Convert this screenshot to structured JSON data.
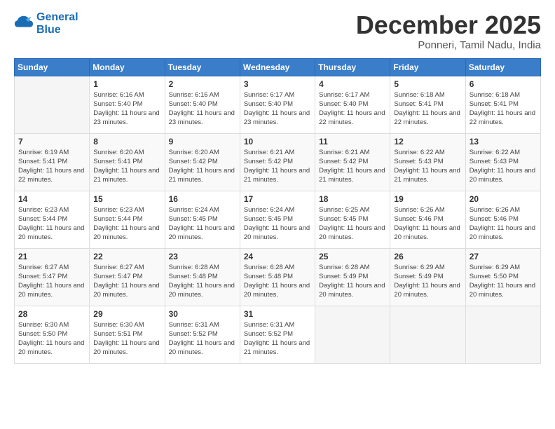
{
  "logo": {
    "line1": "General",
    "line2": "Blue"
  },
  "header": {
    "month": "December 2025",
    "location": "Ponneri, Tamil Nadu, India"
  },
  "weekdays": [
    "Sunday",
    "Monday",
    "Tuesday",
    "Wednesday",
    "Thursday",
    "Friday",
    "Saturday"
  ],
  "weeks": [
    [
      {
        "day": "",
        "info": ""
      },
      {
        "day": "1",
        "info": "Sunrise: 6:16 AM\nSunset: 5:40 PM\nDaylight: 11 hours\nand 23 minutes."
      },
      {
        "day": "2",
        "info": "Sunrise: 6:16 AM\nSunset: 5:40 PM\nDaylight: 11 hours\nand 23 minutes."
      },
      {
        "day": "3",
        "info": "Sunrise: 6:17 AM\nSunset: 5:40 PM\nDaylight: 11 hours\nand 23 minutes."
      },
      {
        "day": "4",
        "info": "Sunrise: 6:17 AM\nSunset: 5:40 PM\nDaylight: 11 hours\nand 22 minutes."
      },
      {
        "day": "5",
        "info": "Sunrise: 6:18 AM\nSunset: 5:41 PM\nDaylight: 11 hours\nand 22 minutes."
      },
      {
        "day": "6",
        "info": "Sunrise: 6:18 AM\nSunset: 5:41 PM\nDaylight: 11 hours\nand 22 minutes."
      }
    ],
    [
      {
        "day": "7",
        "info": ""
      },
      {
        "day": "8",
        "info": "Sunrise: 6:20 AM\nSunset: 5:41 PM\nDaylight: 11 hours\nand 21 minutes."
      },
      {
        "day": "9",
        "info": "Sunrise: 6:20 AM\nSunset: 5:42 PM\nDaylight: 11 hours\nand 21 minutes."
      },
      {
        "day": "10",
        "info": "Sunrise: 6:21 AM\nSunset: 5:42 PM\nDaylight: 11 hours\nand 21 minutes."
      },
      {
        "day": "11",
        "info": "Sunrise: 6:21 AM\nSunset: 5:42 PM\nDaylight: 11 hours\nand 21 minutes."
      },
      {
        "day": "12",
        "info": "Sunrise: 6:22 AM\nSunset: 5:43 PM\nDaylight: 11 hours\nand 21 minutes."
      },
      {
        "day": "13",
        "info": "Sunrise: 6:22 AM\nSunset: 5:43 PM\nDaylight: 11 hours\nand 20 minutes."
      }
    ],
    [
      {
        "day": "14",
        "info": ""
      },
      {
        "day": "15",
        "info": "Sunrise: 6:23 AM\nSunset: 5:44 PM\nDaylight: 11 hours\nand 20 minutes."
      },
      {
        "day": "16",
        "info": "Sunrise: 6:24 AM\nSunset: 5:45 PM\nDaylight: 11 hours\nand 20 minutes."
      },
      {
        "day": "17",
        "info": "Sunrise: 6:24 AM\nSunset: 5:45 PM\nDaylight: 11 hours\nand 20 minutes."
      },
      {
        "day": "18",
        "info": "Sunrise: 6:25 AM\nSunset: 5:45 PM\nDaylight: 11 hours\nand 20 minutes."
      },
      {
        "day": "19",
        "info": "Sunrise: 6:26 AM\nSunset: 5:46 PM\nDaylight: 11 hours\nand 20 minutes."
      },
      {
        "day": "20",
        "info": "Sunrise: 6:26 AM\nSunset: 5:46 PM\nDaylight: 11 hours\nand 20 minutes."
      }
    ],
    [
      {
        "day": "21",
        "info": ""
      },
      {
        "day": "22",
        "info": "Sunrise: 6:27 AM\nSunset: 5:47 PM\nDaylight: 11 hours\nand 20 minutes."
      },
      {
        "day": "23",
        "info": "Sunrise: 6:28 AM\nSunset: 5:48 PM\nDaylight: 11 hours\nand 20 minutes."
      },
      {
        "day": "24",
        "info": "Sunrise: 6:28 AM\nSunset: 5:48 PM\nDaylight: 11 hours\nand 20 minutes."
      },
      {
        "day": "25",
        "info": "Sunrise: 6:28 AM\nSunset: 5:49 PM\nDaylight: 11 hours\nand 20 minutes."
      },
      {
        "day": "26",
        "info": "Sunrise: 6:29 AM\nSunset: 5:49 PM\nDaylight: 11 hours\nand 20 minutes."
      },
      {
        "day": "27",
        "info": "Sunrise: 6:29 AM\nSunset: 5:50 PM\nDaylight: 11 hours\nand 20 minutes."
      }
    ],
    [
      {
        "day": "28",
        "info": "Sunrise: 6:30 AM\nSunset: 5:50 PM\nDaylight: 11 hours\nand 20 minutes."
      },
      {
        "day": "29",
        "info": "Sunrise: 6:30 AM\nSunset: 5:51 PM\nDaylight: 11 hours\nand 20 minutes."
      },
      {
        "day": "30",
        "info": "Sunrise: 6:31 AM\nSunset: 5:52 PM\nDaylight: 11 hours\nand 20 minutes."
      },
      {
        "day": "31",
        "info": "Sunrise: 6:31 AM\nSunset: 5:52 PM\nDaylight: 11 hours\nand 21 minutes."
      },
      {
        "day": "",
        "info": ""
      },
      {
        "day": "",
        "info": ""
      },
      {
        "day": "",
        "info": ""
      }
    ]
  ],
  "week1_day7_info": "Sunrise: 6:19 AM\nSunset: 5:41 PM\nDaylight: 11 hours\nand 22 minutes.",
  "week2_day14_info": "Sunrise: 6:23 AM\nSunset: 5:44 PM\nDaylight: 11 hours\nand 20 minutes.",
  "week3_day21_info": "Sunrise: 6:27 AM\nSunset: 5:47 PM\nDaylight: 11 hours\nand 20 minutes."
}
